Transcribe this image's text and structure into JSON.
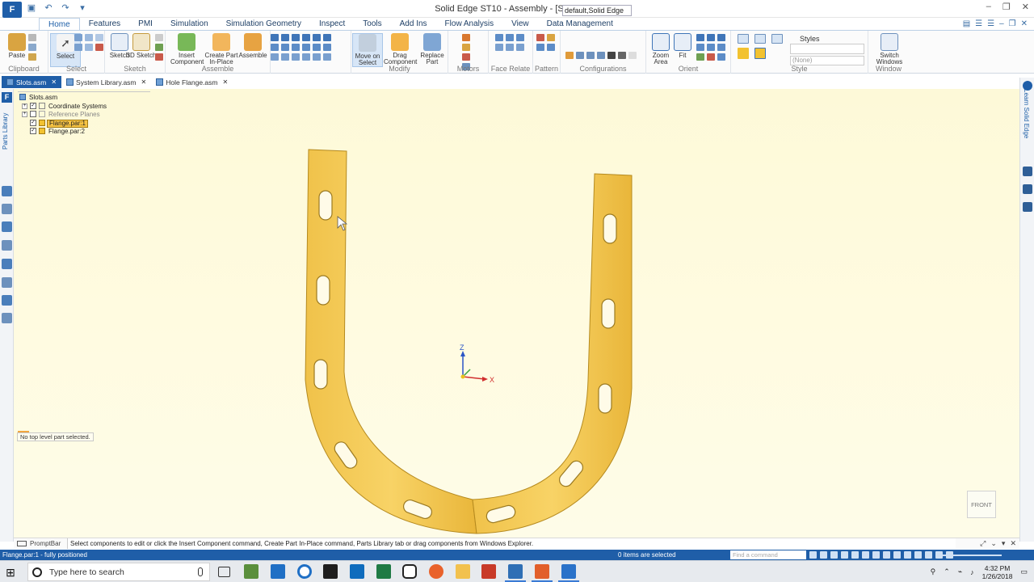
{
  "window": {
    "title": "Solid Edge ST10 - Assembly - [Slots.asm]",
    "app_menu_label": "F"
  },
  "ribbon": {
    "tabs": [
      {
        "label": "Home",
        "active": true
      },
      {
        "label": "Features"
      },
      {
        "label": "PMI"
      },
      {
        "label": "Simulation"
      },
      {
        "label": "Simulation Geometry"
      },
      {
        "label": "Inspect"
      },
      {
        "label": "Tools"
      },
      {
        "label": "Add Ins"
      },
      {
        "label": "Flow Analysis"
      },
      {
        "label": "View"
      },
      {
        "label": "Data Management"
      }
    ],
    "buttons": {
      "paste": "Paste",
      "select": "Select",
      "sketch": "Sketch",
      "sketch3d": "3D Sketch",
      "insert_component": "Insert Component",
      "create_part_in_place": "Create Part In-Place",
      "assemble": "Assemble",
      "move_on_select": "Move on Select",
      "drag_component": "Drag Component",
      "replace_part": "Replace Part",
      "zoom_area": "Zoom Area",
      "fit": "Fit",
      "switch_windows": "Switch Windows"
    },
    "groups": {
      "clipboard": "Clipboard",
      "select": "Select",
      "sketch": "Sketch",
      "assemble": "Assemble",
      "modify": "Modify",
      "motors": "Motors",
      "face_relate": "Face Relate",
      "pattern": "Pattern",
      "configurations": "Configurations",
      "orient": "Orient",
      "style": "Style",
      "window": "Window"
    },
    "configuration_value": "default,Solid Edge",
    "styles_label": "Styles",
    "style_value": "(None)"
  },
  "doc_tabs": [
    {
      "label": "Slots.asm",
      "active": true
    },
    {
      "label": "System Library.asm"
    },
    {
      "label": "Hole Flange.asm"
    }
  ],
  "left_dock": {
    "parts_library_label": "Parts Library"
  },
  "right_dock": {
    "learn_label": "Learn Solid Edge"
  },
  "tree": {
    "root": "Slots.asm",
    "items": [
      {
        "label": "Coordinate Systems",
        "checked": true
      },
      {
        "label": "Reference Planes",
        "checked": false
      },
      {
        "label": "Flange.par:1",
        "checked": true,
        "selected": true
      },
      {
        "label": "Flange.par:2",
        "checked": true
      }
    ]
  },
  "canvas": {
    "status_tip": "No top level part selected.",
    "axis_z": "Z",
    "axis_x": "X",
    "view_cube_label": "FRONT"
  },
  "prompt_bar": {
    "label": "PromptBar",
    "text": "Select components to edit or click the Insert Component command, Create Part In-Place command, Parts Library tab or drag components from Windows Explorer."
  },
  "status_bar": {
    "left": "Flange.par:1 - fully positioned",
    "selection": "0 items are selected",
    "find_placeholder": "Find a command"
  },
  "taskbar": {
    "search_placeholder": "Type here to search",
    "time": "4:32 PM",
    "date": "1/26/2018"
  }
}
